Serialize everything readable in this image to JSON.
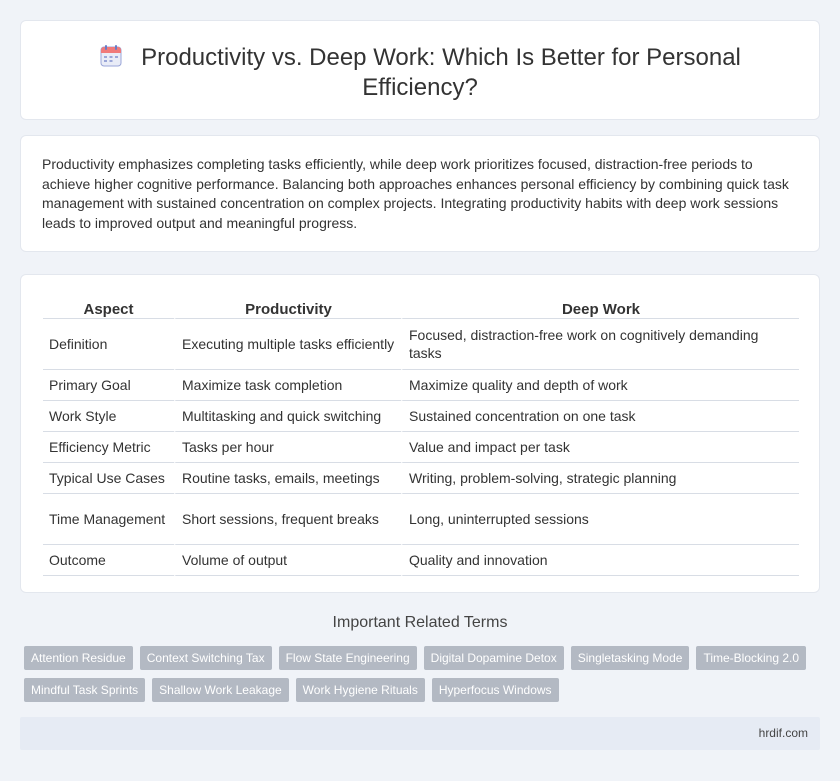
{
  "header": {
    "icon": "calendar-icon",
    "title": "Productivity vs. Deep Work: Which Is Better for Personal Efficiency?"
  },
  "intro": {
    "text": "Productivity emphasizes completing tasks efficiently, while deep work prioritizes focused, distraction-free periods to achieve higher cognitive performance. Balancing both approaches enhances personal efficiency by combining quick task management with sustained concentration on complex projects. Integrating productivity habits with deep work sessions leads to improved output and meaningful progress."
  },
  "table": {
    "headers": [
      "Aspect",
      "Productivity",
      "Deep Work"
    ],
    "rows": [
      [
        "Definition",
        "Executing multiple tasks efficiently",
        "Focused, distraction-free work on cognitively demanding tasks"
      ],
      [
        "Primary Goal",
        "Maximize task completion",
        "Maximize quality and depth of work"
      ],
      [
        "Work Style",
        "Multitasking and quick switching",
        "Sustained concentration on one task"
      ],
      [
        "Efficiency Metric",
        "Tasks per hour",
        "Value and impact per task"
      ],
      [
        "Typical Use Cases",
        "Routine tasks, emails, meetings",
        "Writing, problem-solving, strategic planning"
      ],
      [
        "Time Management",
        "Short sessions, frequent breaks",
        "Long, uninterrupted sessions"
      ],
      [
        "Outcome",
        "Volume of output",
        "Quality and innovation"
      ]
    ]
  },
  "related": {
    "title": "Important Related Terms",
    "tags_row1": [
      "Attention Residue",
      "Context Switching Tax",
      "Flow State Engineering",
      "Digital Dopamine Detox",
      "Singletasking Mode",
      "Time-Blocking 2.0"
    ],
    "tags_row2": [
      "Mindful Task Sprints",
      "Shallow Work Leakage",
      "Work Hygiene Rituals",
      "Hyperfocus Windows"
    ]
  },
  "footer": {
    "text": "hrdif.com"
  },
  "colors": {
    "tag_bg": "#b3b9c3",
    "page_bg": "#f0f3f8",
    "footer_bg": "#e6ebf4"
  }
}
